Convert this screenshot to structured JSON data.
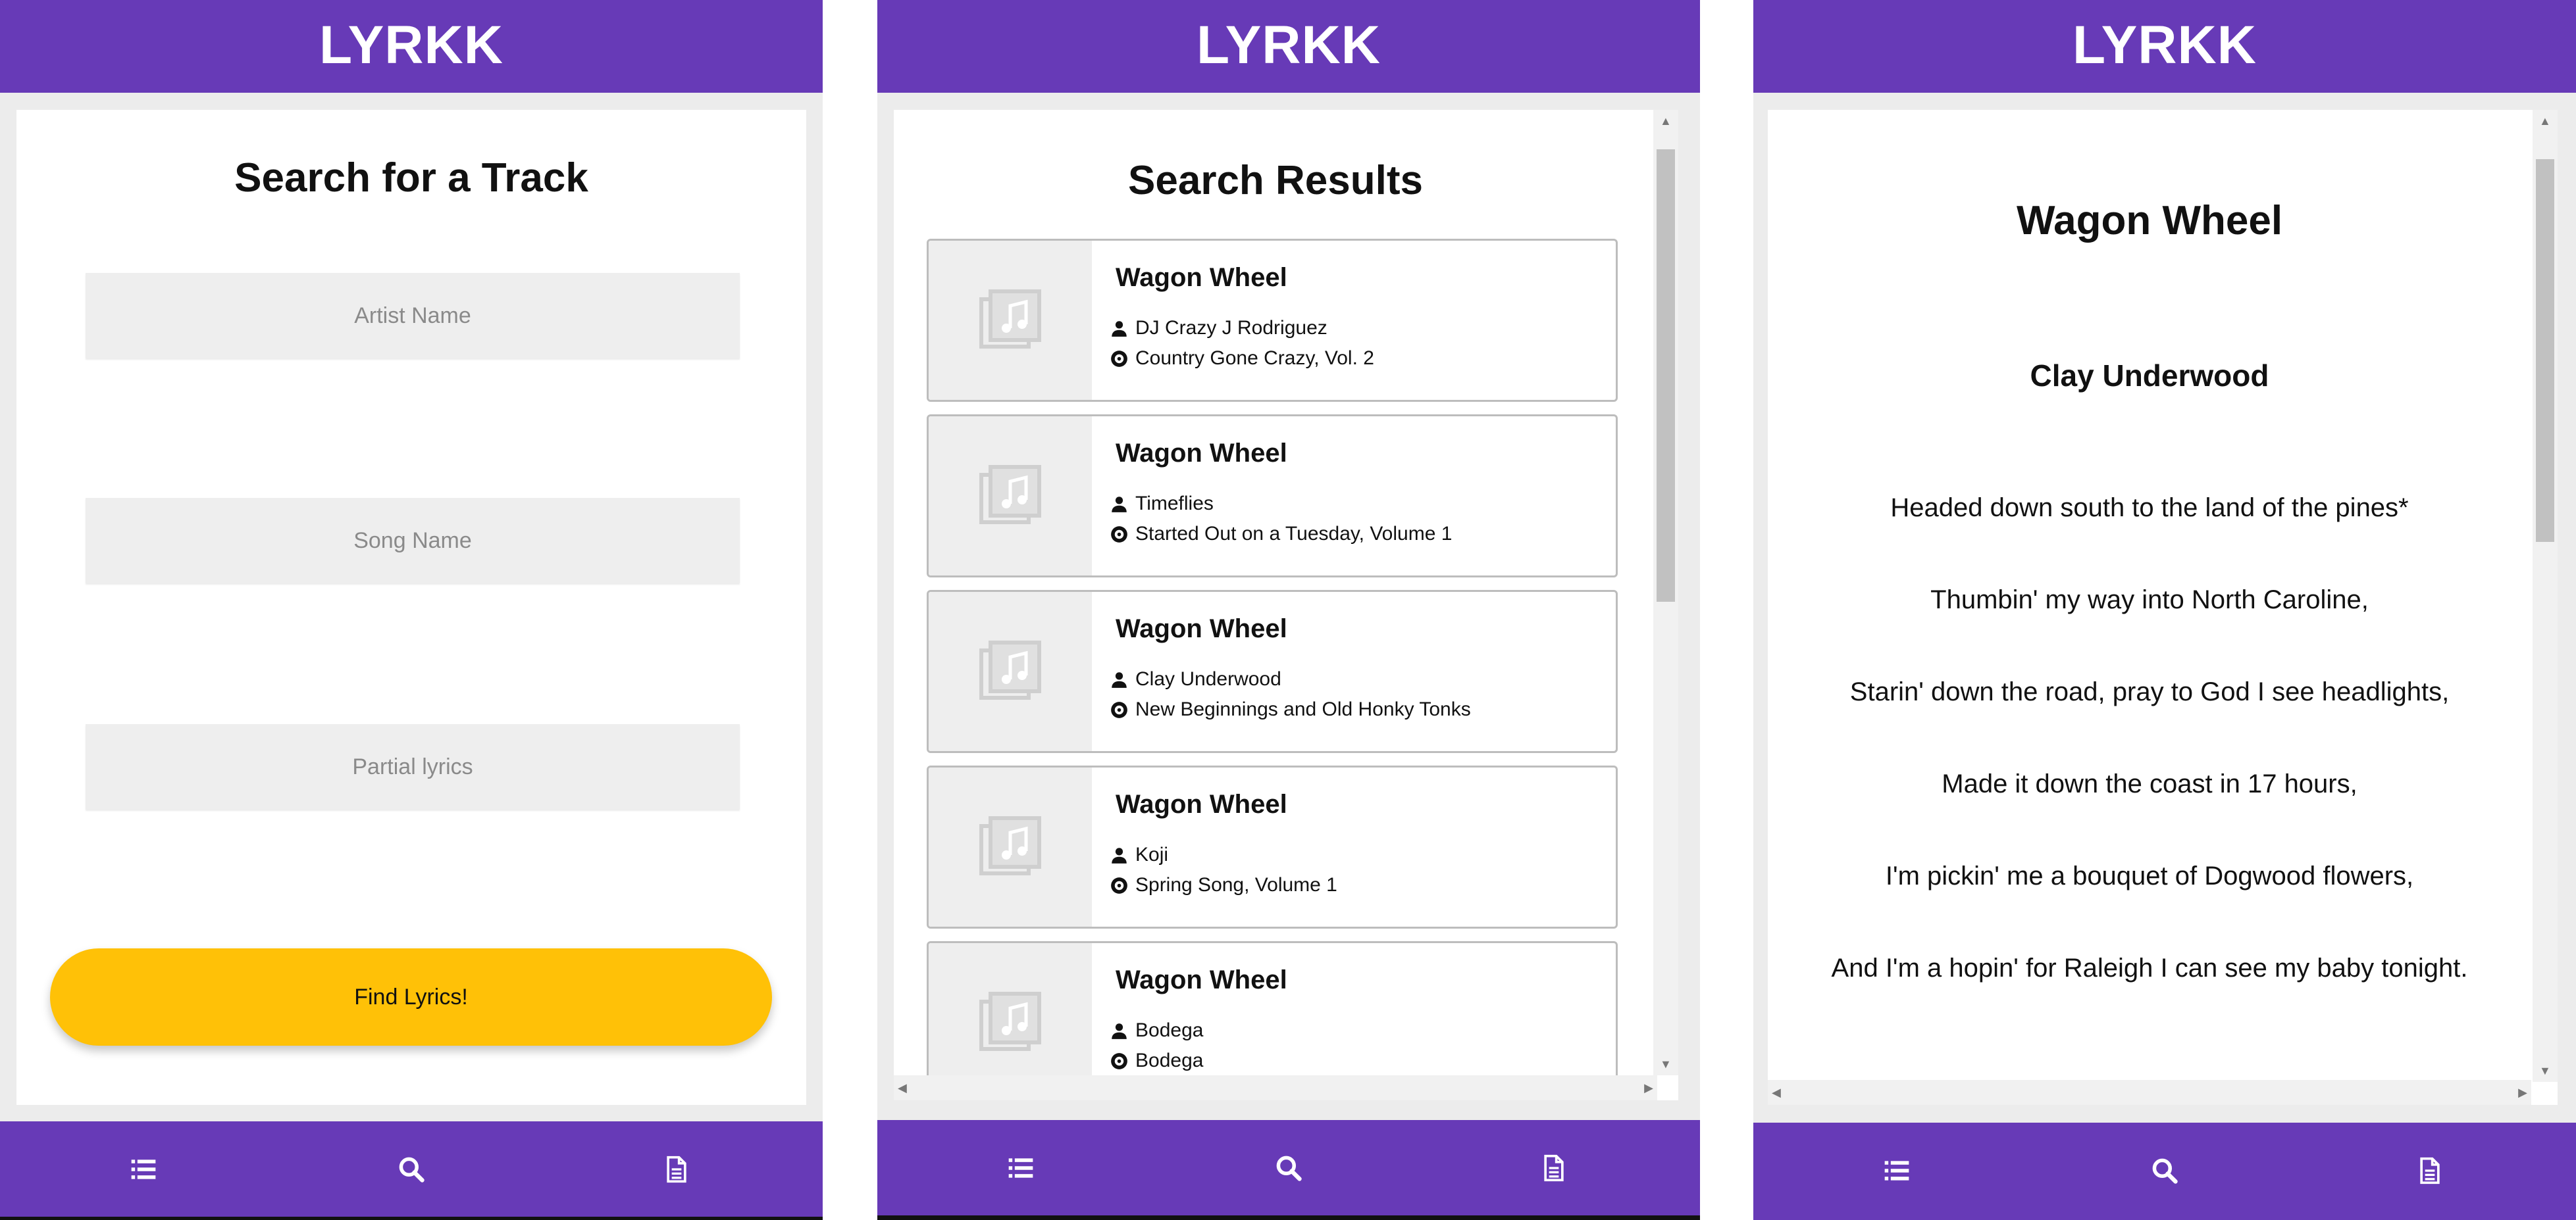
{
  "app": {
    "title": "LYRKK",
    "accent": "#673ab7",
    "button_color": "#ffc107"
  },
  "nav": {
    "icons": [
      "list-icon",
      "search-icon",
      "document-icon"
    ]
  },
  "search_screen": {
    "heading": "Search for a Track",
    "fields": [
      {
        "placeholder": "Artist Name",
        "value": ""
      },
      {
        "placeholder": "Song Name",
        "value": ""
      },
      {
        "placeholder": "Partial lyrics",
        "value": ""
      }
    ],
    "button_label": "Find Lyrics!"
  },
  "results_screen": {
    "heading": "Search Results",
    "results": [
      {
        "title": "Wagon Wheel",
        "artist": "DJ Crazy J Rodriguez",
        "album": "Country Gone Crazy, Vol. 2"
      },
      {
        "title": "Wagon Wheel",
        "artist": "Timeflies",
        "album": "Started Out on a Tuesday, Volume 1"
      },
      {
        "title": "Wagon Wheel",
        "artist": "Clay Underwood",
        "album": "New Beginnings and Old Honky Tonks"
      },
      {
        "title": "Wagon Wheel",
        "artist": "Koji",
        "album": "Spring Song, Volume 1"
      },
      {
        "title": "Wagon Wheel",
        "artist": "Bodega",
        "album": "Bodega"
      }
    ]
  },
  "lyrics_screen": {
    "song": "Wagon Wheel",
    "artist": "Clay Underwood",
    "lines": [
      "Headed down south to the land of the pines*",
      "Thumbin' my way into North Caroline,",
      "Starin' down the road, pray to God I see headlights,",
      "Made it down the coast in 17 hours,",
      "I'm pickin' me a bouquet of Dogwood flowers,",
      "And I'm a hopin' for Raleigh I can see my baby tonight."
    ]
  }
}
